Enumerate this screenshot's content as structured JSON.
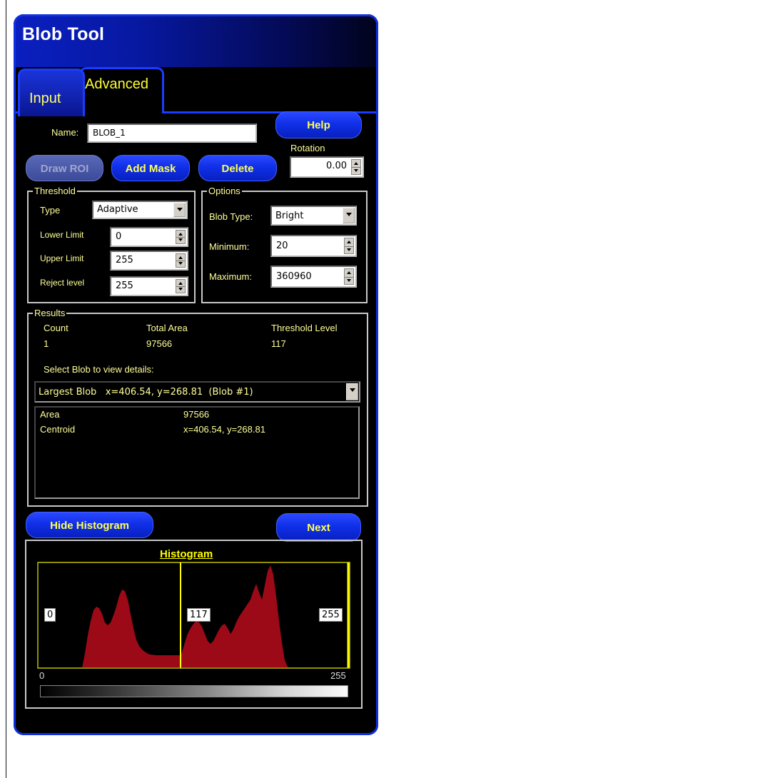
{
  "window": {
    "title": "Blob Tool"
  },
  "tabs": [
    {
      "label": "Input",
      "active": true
    },
    {
      "label": "Advanced",
      "active": false
    }
  ],
  "name": {
    "label": "Name:",
    "value": "BLOB_1"
  },
  "buttons": {
    "help": "Help",
    "draw_roi": "Draw ROI",
    "add_mask": "Add Mask",
    "delete": "Delete",
    "hide_histogram": "Hide Histogram",
    "next": "Next"
  },
  "rotation": {
    "label": "Rotation",
    "value": "0.00"
  },
  "threshold": {
    "title": "Threshold",
    "type_label": "Type",
    "type_value": "Adaptive",
    "lower_label": "Lower Limit",
    "lower_value": "0",
    "upper_label": "Upper Limit",
    "upper_value": "255",
    "reject_label": "Reject level",
    "reject_value": "255"
  },
  "options": {
    "title": "Options",
    "blob_type_label": "Blob Type:",
    "blob_type_value": "Bright",
    "min_label": "Minimum:",
    "min_value": "20",
    "max_label": "Maximum:",
    "max_value": "360960"
  },
  "results": {
    "title": "Results",
    "headers": [
      "Count",
      "Total Area",
      "Threshold Level"
    ],
    "values": [
      "1",
      "97566",
      "117"
    ],
    "select_prompt": "Select Blob to view details:",
    "selected_blob": "Largest Blob   x=406.54, y=268.81  (Blob #1)",
    "details": [
      {
        "key": "Area",
        "value": "97566"
      },
      {
        "key": "Centroid",
        "value": "x=406.54, y=268.81"
      }
    ]
  },
  "histogram": {
    "title": "Histogram",
    "lower_marker": "0",
    "threshold_marker": "117",
    "upper_marker": "255",
    "axis_min": "0",
    "axis_max": "255",
    "colors": {
      "fill": "#9b0a16",
      "marker": "#ffff00",
      "frame": "#c0c000"
    }
  },
  "colors": {
    "accent": "#1030e8",
    "label_text": "#ffff99",
    "button_text": "#ffff55"
  }
}
